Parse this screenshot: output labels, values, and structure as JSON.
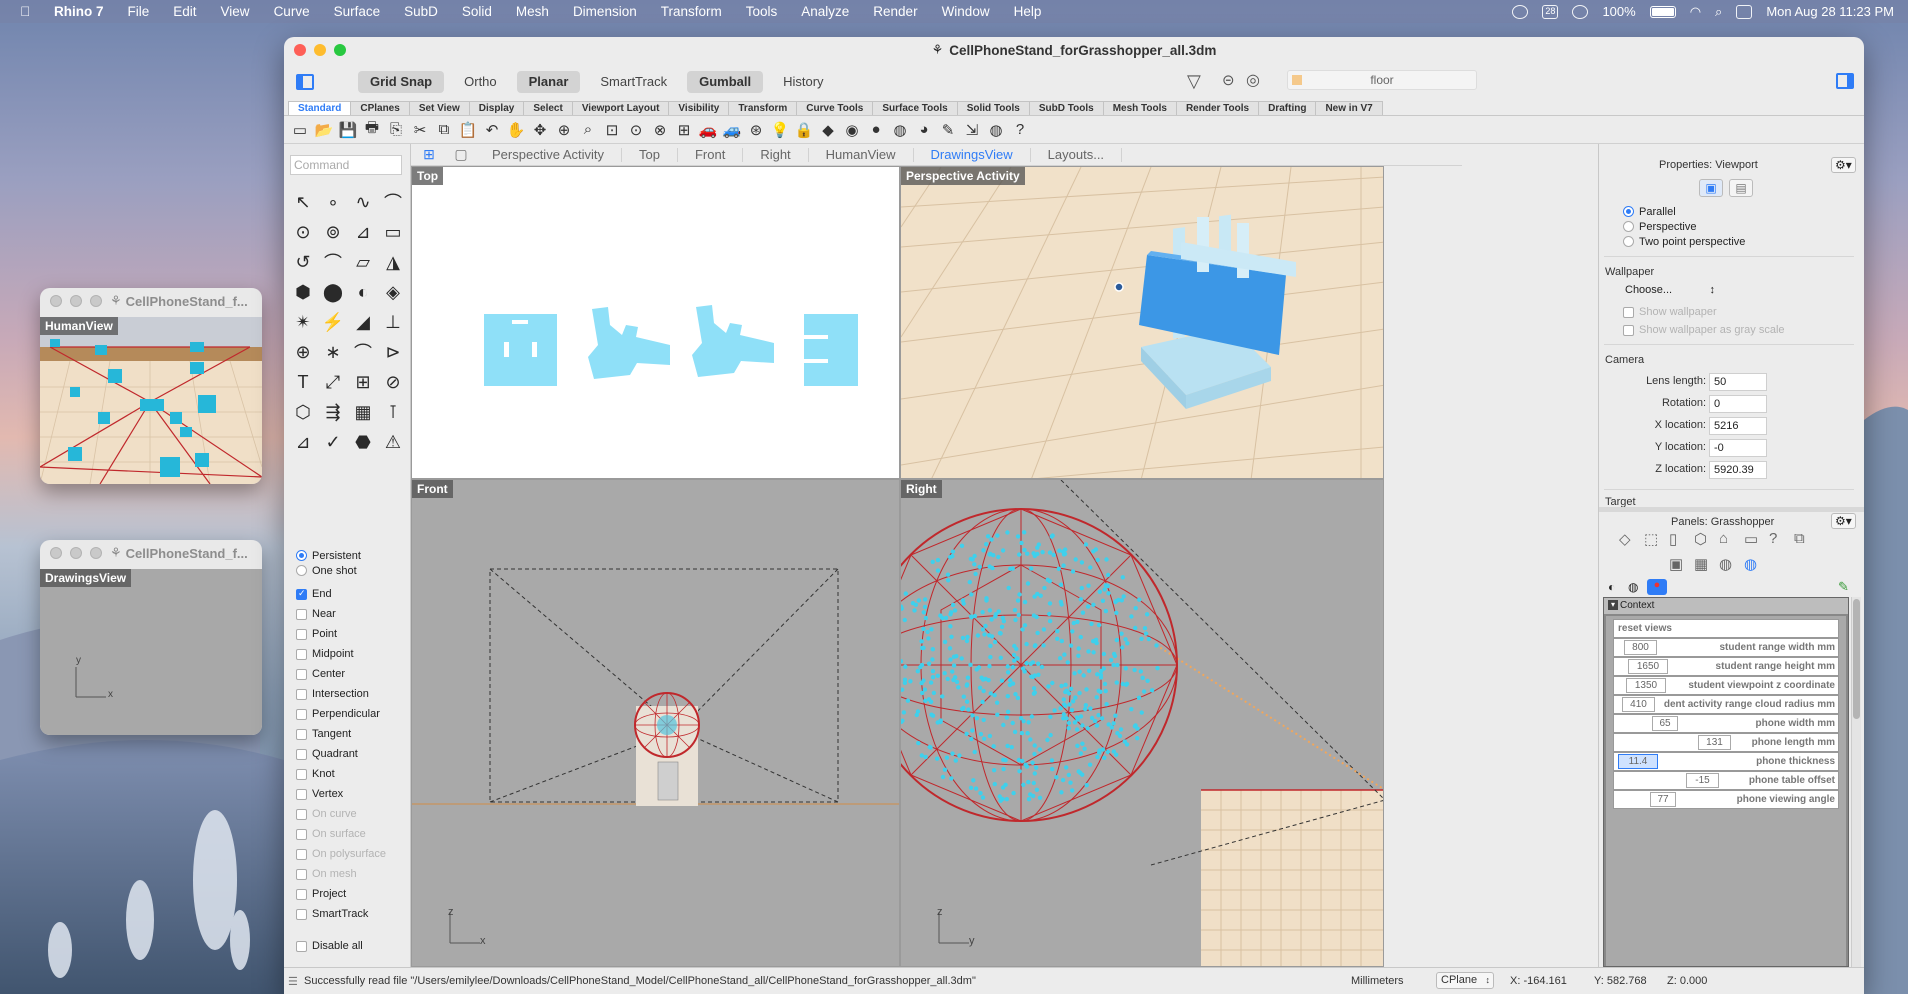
{
  "menubar": {
    "app_name": "Rhino 7",
    "items": [
      "File",
      "Edit",
      "View",
      "Curve",
      "Surface",
      "SubD",
      "Solid",
      "Mesh",
      "Dimension",
      "Transform",
      "Tools",
      "Analyze",
      "Render",
      "Window",
      "Help"
    ],
    "calendar_day": "28",
    "battery": "100%",
    "clock": "Mon Aug 28  11:23 PM"
  },
  "mini_windows": [
    {
      "title": "CellPhoneStand_f...",
      "viewport": "HumanView"
    },
    {
      "title": "CellPhoneStand_f...",
      "viewport": "DrawingsView"
    }
  ],
  "window": {
    "title": "CellPhoneStand_forGrasshopper_all.3dm",
    "toggles": [
      {
        "label": "Grid Snap",
        "on": true
      },
      {
        "label": "Ortho",
        "on": false
      },
      {
        "label": "Planar",
        "on": true
      },
      {
        "label": "SmartTrack",
        "on": false
      },
      {
        "label": "Gumball",
        "on": true
      },
      {
        "label": "History",
        "on": false
      }
    ],
    "layer": "floor"
  },
  "toolbar_tabs": [
    "Standard",
    "CPlanes",
    "Set View",
    "Display",
    "Select",
    "Viewport Layout",
    "Visibility",
    "Transform",
    "Curve Tools",
    "Surface Tools",
    "Solid Tools",
    "SubD Tools",
    "Mesh Tools",
    "Render Tools",
    "Drafting",
    "New in V7"
  ],
  "toolbar_icons": [
    "new-file-icon",
    "open-file-icon",
    "save-icon",
    "print-icon",
    "import-icon",
    "cut-icon",
    "copy-icon",
    "paste-icon",
    "undo-icon",
    "pan-icon",
    "rotate-view-icon",
    "zoom-icon",
    "zoom-window-icon",
    "zoom-extents-icon",
    "zoom-selected-icon",
    "zoom-all-icon",
    "four-viewports-icon",
    "car-icon",
    "car-wire-icon",
    "target-icon",
    "bulb-icon",
    "lock-icon",
    "layers-icon",
    "color-wheel-icon",
    "sphere-shade-icon",
    "sphere-wire-icon",
    "render-sphere-icon",
    "pencil-icon",
    "dimension-icon",
    "grasshopper-icon",
    "help-icon"
  ],
  "toolbar_glyphs": [
    "▭",
    "📂",
    "💾",
    "🖶",
    "⎘",
    "✂",
    "⧉",
    "📋",
    "↶",
    "✋",
    "✥",
    "⊕",
    "⌕",
    "⊡",
    "⊙",
    "⊗",
    "⊞",
    "🚗",
    "🚙",
    "⊛",
    "💡",
    "🔒",
    "◆",
    "◉",
    "●",
    "◍",
    "◕",
    "✎",
    "⇲",
    "◍",
    "?"
  ],
  "command": {
    "placeholder": "Command"
  },
  "tools": [
    "↖",
    "∘",
    "∿",
    "⌒",
    "⊙",
    "⊚",
    "⊿",
    "▭",
    "↺",
    "⌒",
    "▱",
    "◮",
    "⬢",
    "⬤",
    "◐",
    "◈",
    "✴",
    "⚡",
    "◢",
    "⊥",
    "⊕",
    "∗",
    "⌒",
    "⊳",
    "T",
    "⤢",
    "⊞",
    "⊘",
    "⬡",
    "⇶",
    "▦",
    "⊺",
    "⊿",
    "✓",
    "⬣",
    "⚠"
  ],
  "osnap": {
    "modes": [
      {
        "label": "Persistent",
        "on": true
      },
      {
        "label": "One shot",
        "on": false
      }
    ],
    "items": [
      {
        "label": "End",
        "checked": true,
        "enabled": true
      },
      {
        "label": "Near",
        "checked": false,
        "enabled": true
      },
      {
        "label": "Point",
        "checked": false,
        "enabled": true
      },
      {
        "label": "Midpoint",
        "checked": false,
        "enabled": true
      },
      {
        "label": "Center",
        "checked": false,
        "enabled": true
      },
      {
        "label": "Intersection",
        "checked": false,
        "enabled": true
      },
      {
        "label": "Perpendicular",
        "checked": false,
        "enabled": true
      },
      {
        "label": "Tangent",
        "checked": false,
        "enabled": true
      },
      {
        "label": "Quadrant",
        "checked": false,
        "enabled": true
      },
      {
        "label": "Knot",
        "checked": false,
        "enabled": true
      },
      {
        "label": "Vertex",
        "checked": false,
        "enabled": true
      },
      {
        "label": "On curve",
        "checked": false,
        "enabled": false
      },
      {
        "label": "On surface",
        "checked": false,
        "enabled": false
      },
      {
        "label": "On polysurface",
        "checked": false,
        "enabled": false
      },
      {
        "label": "On mesh",
        "checked": false,
        "enabled": false
      },
      {
        "label": "Project",
        "checked": false,
        "enabled": true
      },
      {
        "label": "SmartTrack",
        "checked": false,
        "enabled": true
      }
    ],
    "disable_all": "Disable all"
  },
  "viewport_tabs": [
    {
      "label": "Perspective Activity",
      "active": false
    },
    {
      "label": "Top",
      "active": false
    },
    {
      "label": "Front",
      "active": false
    },
    {
      "label": "Right",
      "active": false
    },
    {
      "label": "HumanView",
      "active": false
    },
    {
      "label": "DrawingsView",
      "active": true
    },
    {
      "label": "Layouts...",
      "active": false
    }
  ],
  "viewports": {
    "top": "Top",
    "perspective": "Perspective Activity",
    "front": "Front",
    "right": "Right",
    "axis_x": "x",
    "axis_y": "y",
    "axis_z": "z"
  },
  "properties": {
    "header": "Properties: Viewport",
    "projection": [
      {
        "label": "Parallel",
        "on": true
      },
      {
        "label": "Perspective",
        "on": false
      },
      {
        "label": "Two point perspective",
        "on": false
      }
    ],
    "wallpaper": {
      "heading": "Wallpaper",
      "choose": "Choose...",
      "show": "Show wallpaper",
      "gray": "Show wallpaper as gray scale"
    },
    "camera": {
      "heading": "Camera",
      "fields": [
        {
          "label": "Lens length:",
          "value": "50"
        },
        {
          "label": "Rotation:",
          "value": "0"
        },
        {
          "label": "X location:",
          "value": "5216"
        },
        {
          "label": "Y location:",
          "value": "-0"
        },
        {
          "label": "Z location:",
          "value": "5920.39"
        }
      ]
    },
    "target": "Target"
  },
  "panels": {
    "header": "Panels: Grasshopper",
    "context_title": "Context",
    "reset_views": "reset views",
    "params": [
      {
        "value": "800",
        "label": "student range width mm"
      },
      {
        "value": "1650",
        "label": "student range height mm"
      },
      {
        "value": "1350",
        "label": "student viewpoint z coordinate"
      },
      {
        "value": "410",
        "label": "dent activity range cloud radius mm"
      },
      {
        "value": "65",
        "label": "phone width mm"
      },
      {
        "value": "131",
        "label": "phone length mm"
      },
      {
        "value": "11.4",
        "label": "phone thickness"
      },
      {
        "value": "-15",
        "label": "phone table offset"
      },
      {
        "value": "77",
        "label": "phone viewing angle"
      }
    ]
  },
  "status": {
    "message": "Successfully read file \"/Users/emilylee/Downloads/CellPhoneStand_Model/CellPhoneStand_all/CellPhoneStand_forGrasshopper_all.3dm\"",
    "units": "Millimeters",
    "cplane": "CPlane",
    "x": "X: -164.161",
    "y": "Y: 582.768",
    "z": "Z: 0.000"
  },
  "colors": {
    "accent": "#2f7cf6",
    "part_fill": "#8fe0f8",
    "geodesic": "#c0282c",
    "viewport_gray": "#a9a9a9",
    "floor_tile": "#efdcc2"
  }
}
